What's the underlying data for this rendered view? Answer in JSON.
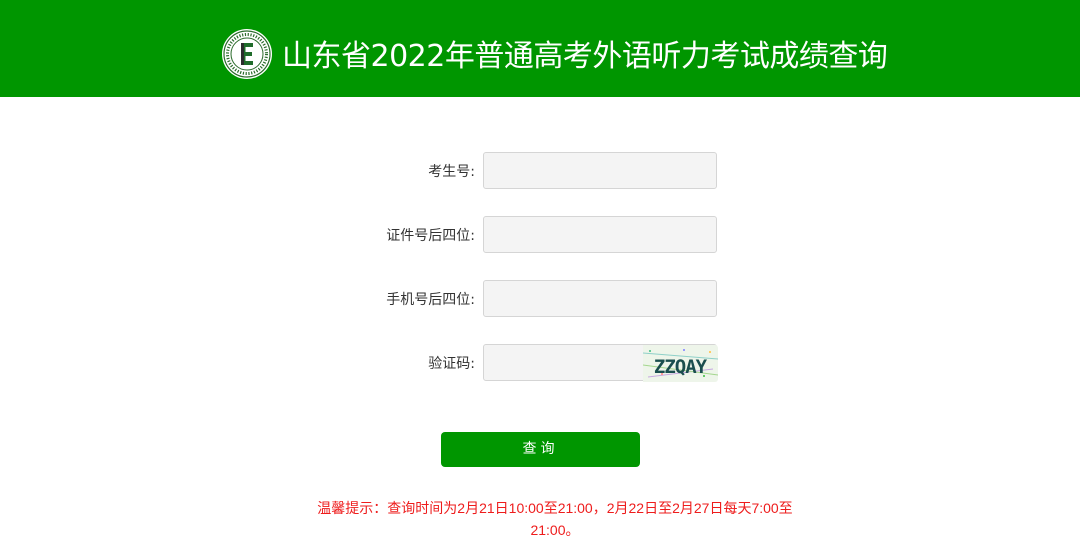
{
  "header": {
    "logo_icon": "exam-institute-seal-logo",
    "title": "山东省2022年普通高考外语听力考试成绩查询"
  },
  "form": {
    "exam_number_label": "考生号:",
    "id_last4_label": "证件号后四位:",
    "phone_last4_label": "手机号后四位:",
    "captcha_label": "验证码:",
    "captcha_text": "ZZQAY",
    "exam_number_value": "",
    "id_last4_value": "",
    "phone_last4_value": "",
    "captcha_value": ""
  },
  "actions": {
    "query_label": "查询"
  },
  "notice": {
    "text": "温馨提示：查询时间为2月21日10:00至21:00，2月22日至2月27日每天7:00至21:00。"
  },
  "colors": {
    "brand_green": "#009600",
    "notice_red": "#ee1c1c"
  }
}
